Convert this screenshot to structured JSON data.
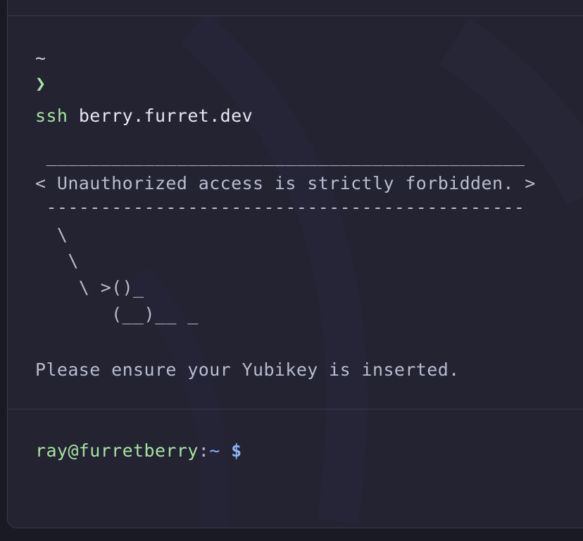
{
  "terminal": {
    "cwd": "~",
    "prompt_symbol": "❯",
    "command": {
      "bin": "ssh",
      "arg": "berry.furret.dev"
    },
    "banner_lines": [
      " ____________________________________________",
      "< Unauthorized access is strictly forbidden. >",
      " --------------------------------------------",
      "  \\",
      "   \\",
      "    \\ >()_",
      "       (__)__ _"
    ],
    "message": "Please ensure your Yubikey is inserted.",
    "remote_prompt": {
      "user_host": "ray@furretberry",
      "colon": ":",
      "path": "~",
      "dollar": "$"
    }
  },
  "colors": {
    "background": "#232332",
    "green": "#a6e3a1",
    "blue": "#89b4fa",
    "text": "#b8bccf"
  }
}
